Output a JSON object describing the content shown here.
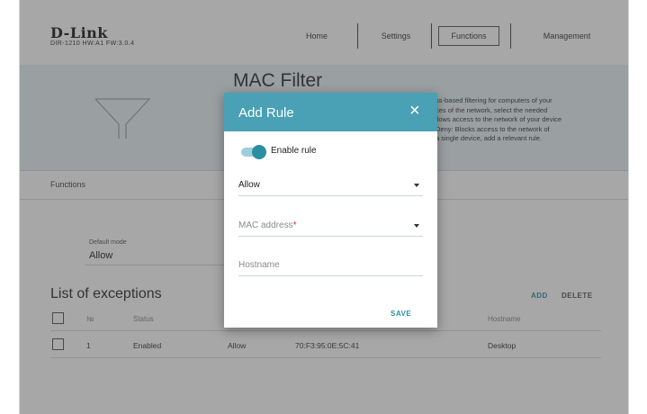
{
  "header": {
    "logo": "D-Link",
    "hw_info": "DIR-1210 HW:A1 FW:3.0.4",
    "nav": [
      "Home",
      "Settings",
      "Functions",
      "Management"
    ],
    "active_nav": "Functions"
  },
  "page": {
    "title": "MAC Filter",
    "description_lines": [
      "ss-based filtering for computers of your",
      "ces of the network, select the needed",
      "llows access to the network of your device",
      "Deny: Blocks access to the network of",
      "a single device, add a relevant rule."
    ],
    "section": "Functions",
    "default_mode_label": "Default mode",
    "default_mode_value": "Allow"
  },
  "exceptions": {
    "title": "List of exceptions",
    "add_label": "ADD",
    "delete_label": "DELETE",
    "columns": [
      "№",
      "Status",
      "Hostname"
    ],
    "rows": [
      {
        "num": "1",
        "status": "Enabled",
        "action": "Allow",
        "mac": "70:F3:95:0E:5C:41",
        "hostname": "Desktop"
      }
    ]
  },
  "modal": {
    "title": "Add Rule",
    "close_icon": "close-icon",
    "enable_label": "Enable rule",
    "enabled": true,
    "action_value": "Allow",
    "mac_placeholder": "MAC address",
    "mac_required_mark": "*",
    "hostname_placeholder": "Hostname",
    "save_label": "SAVE"
  },
  "colors": {
    "accent": "#4aa0b5",
    "link": "#2a8fa3",
    "banner": "#e8f3f6",
    "required": "#d0342c"
  }
}
